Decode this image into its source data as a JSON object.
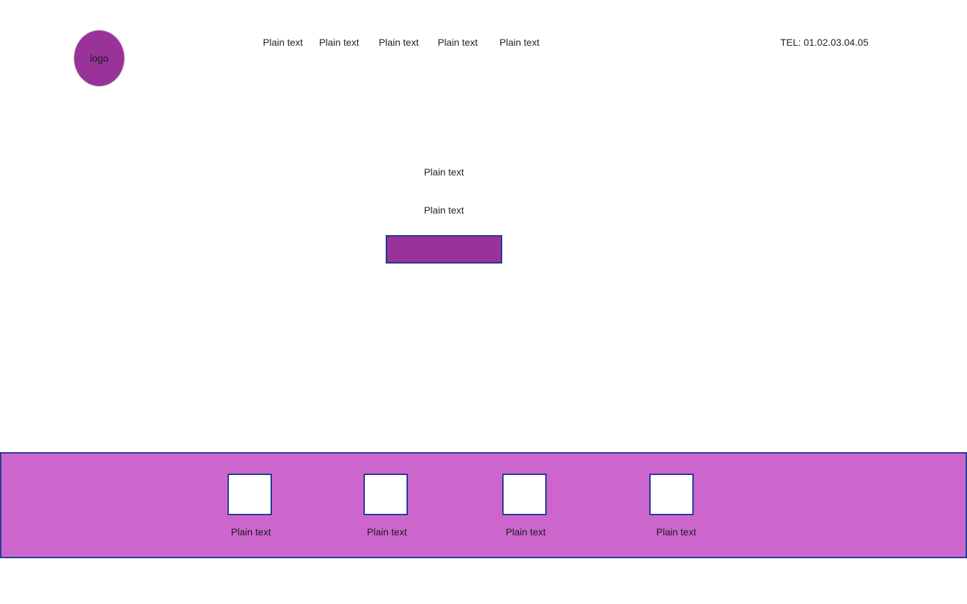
{
  "header": {
    "logo_text": "logo",
    "nav": [
      {
        "label": "Plain text"
      },
      {
        "label": "Plain text"
      },
      {
        "label": "Plain text"
      },
      {
        "label": "Plain text"
      },
      {
        "label": "Plain text"
      }
    ],
    "phone": "TEL: 01.02.03.04.05"
  },
  "hero": {
    "line1": "Plain text",
    "line2": "Plain text",
    "button_label": ""
  },
  "footer": {
    "items": [
      {
        "label": "Plain text"
      },
      {
        "label": "Plain text"
      },
      {
        "label": "Plain text"
      },
      {
        "label": "Plain text"
      }
    ]
  },
  "colors": {
    "accent_purple": "#993399",
    "footer_background": "#cc66cc",
    "border_navy": "#1f3a93"
  }
}
